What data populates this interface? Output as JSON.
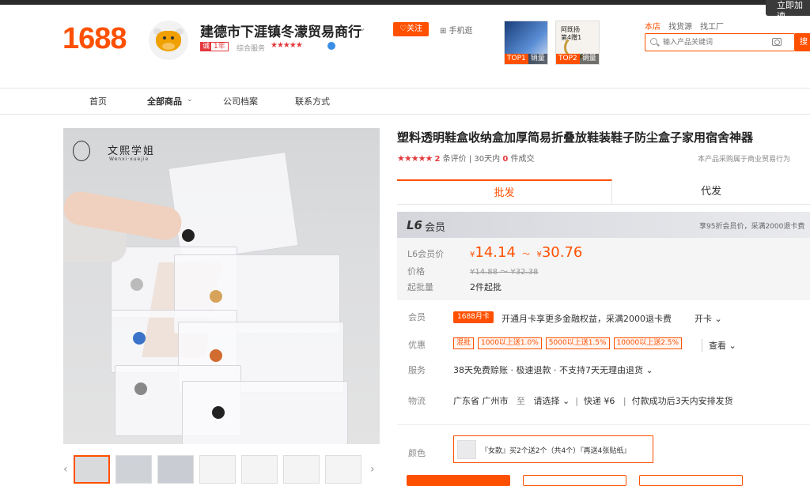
{
  "topbar": {
    "right_button": "立即加速"
  },
  "header": {
    "logo": "1688",
    "shop_name": "建德市下涯镇冬濛贸易商行",
    "year_badge_prefix": "诚",
    "year_badge": "1年",
    "service_label": "综合服务",
    "service_stars": "★★★★★",
    "follow_label": "♡关注",
    "mobile_label": "⊞ 手机逛",
    "top_products": [
      {
        "badge": "TOP1",
        "label": "销量"
      },
      {
        "badge": "TOP2",
        "label": "销量",
        "image_text": "阿既扬\n第4赠1"
      }
    ]
  },
  "search": {
    "tabs": [
      "本店",
      "找货源",
      "找工厂"
    ],
    "placeholder": "输入产品关键词",
    "button": "搜索"
  },
  "nav": {
    "items": [
      "首页",
      "全部商品",
      "公司档案",
      "联系方式"
    ]
  },
  "product": {
    "brand_text": "文熙学姐",
    "brand_sub": "Wenxi·xuejie",
    "title": "塑料透明鞋盒收纳盒加厚简易折叠放鞋装鞋子防尘盒子家用宿舍神器",
    "stars": "★★★★★",
    "reviews_count": "2",
    "reviews_label": "条评价",
    "sales_period": "30天内",
    "sales_count": "0",
    "sales_label": "件成交",
    "purchase_note": "本产品采购属于商业贸易行为",
    "tabs": [
      "批发",
      "代发"
    ],
    "member_level": "L6",
    "member_label": "会员",
    "member_note": "享95折会员价，采满2000退卡费",
    "price_labels": {
      "member": "L6会员价",
      "price": "价格",
      "moq": "起批量"
    },
    "member_price_low": "14.14",
    "member_price_high": "30.76",
    "currency": "¥",
    "original_price": "¥14.88 ～ ¥32.38",
    "moq": "2件起批",
    "row_labels": {
      "member": "会员",
      "discount": "优惠",
      "service": "服务",
      "logistics": "物流",
      "color": "颜色"
    },
    "member_card_badge": "1688月卡",
    "member_card_text": "开通月卡享更多金融权益，采满2000退卡费",
    "open_card": "开卡 ⌄",
    "coupons": [
      "混批",
      "1000以上送1.0%",
      "5000以上送1.5%",
      "10000以上送2.5%"
    ],
    "view_more": "查看 ⌄",
    "service_text": "38天免费赊账 · 极速退款 · 不支持7天无理由退货 ⌄",
    "logistics": {
      "origin": "广东省 广州市",
      "to": "至",
      "select": "请选择 ⌄",
      "express": "快递 ¥6",
      "ship_note": "付款成功后3天内安排发货"
    },
    "color_option": "『女款』买2个送2个（共4个）『再送4张贴纸』"
  },
  "colors": {
    "accent": "#ff5000",
    "red": "#e4393c"
  }
}
